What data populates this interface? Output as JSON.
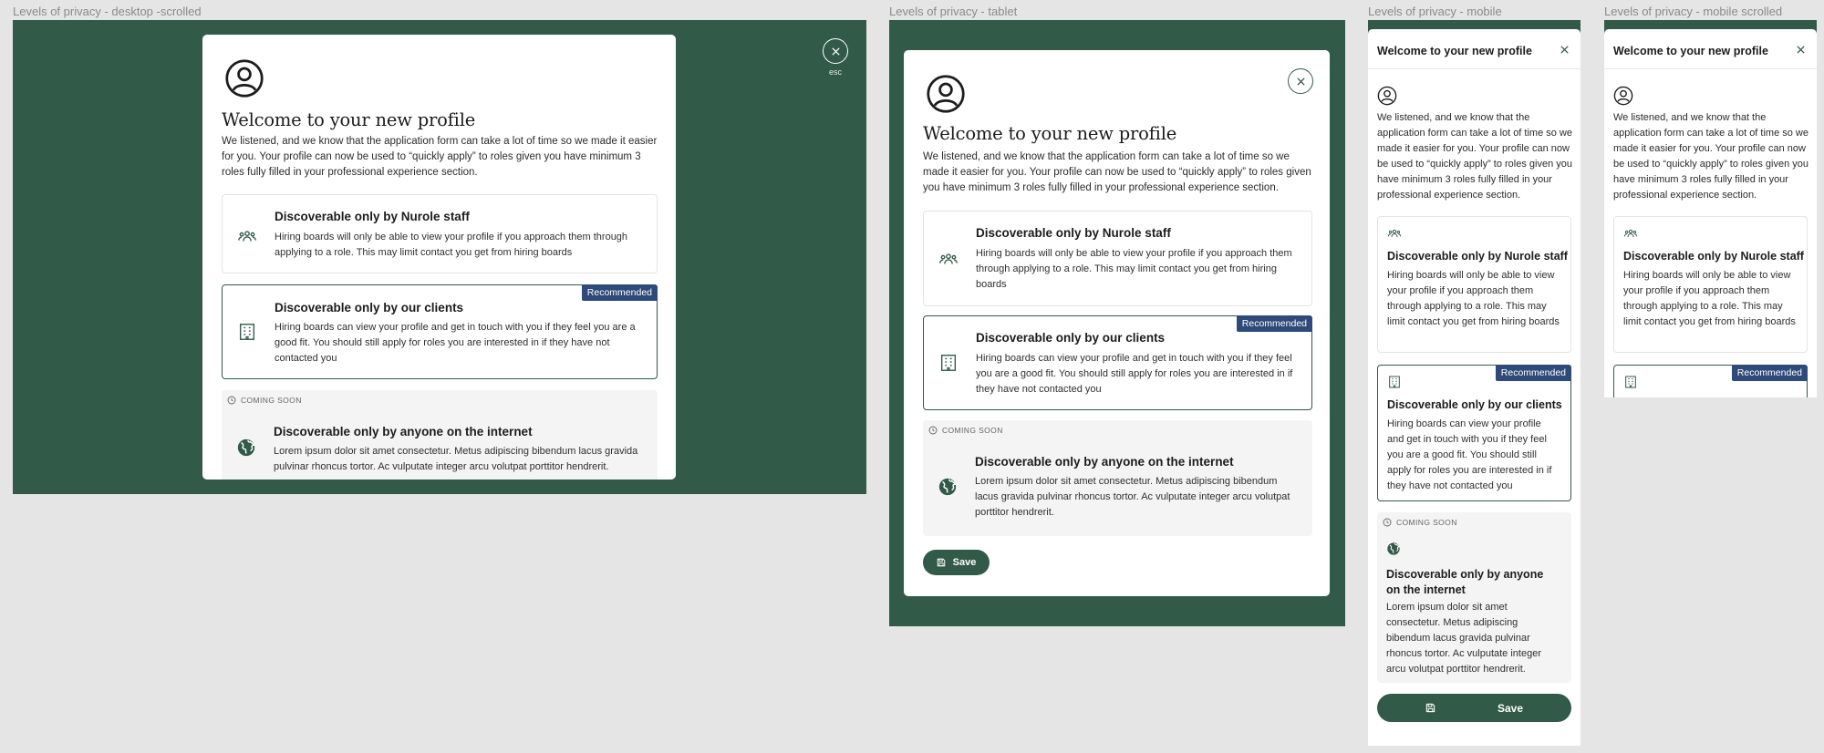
{
  "frames": {
    "desktop": "Levels of privacy - desktop -scrolled",
    "tablet": "Levels of privacy - tablet",
    "mobile": "Levels of privacy - mobile",
    "mobile_scrolled": "Levels of privacy - mobile scrolled"
  },
  "modal": {
    "title": "Welcome to your new profile",
    "intro": "We listened, and we know that the application form can take a lot of time so we made it easier for you. Your profile can now be used to “quickly apply” to roles given you have minimum 3 roles fully filled in your professional experience section.",
    "esc_label": "esc",
    "save_label": "Save",
    "options": [
      {
        "title": "Discoverable only by Nurole staff",
        "description": "Hiring boards will only be able to view your profile if you approach them through applying to a role. This may limit contact you get from hiring boards",
        "icon": "group-icon"
      },
      {
        "title": "Discoverable only by our clients",
        "description": "Hiring boards can view your profile and get in touch with you if they feel you are a good fit. You should still apply for roles you are interested in if they have not contacted you",
        "badge": "Recommended",
        "icon": "building-icon"
      },
      {
        "title": "Discoverable only by anyone on the internet",
        "description": "Lorem ipsum dolor sit amet consectetur. Metus adipiscing bibendum lacus gravida pulvinar rhoncus tortor. Ac vulputate integer arcu volutpat porttitor hendrerit.",
        "status": "COMING SOON",
        "icon": "globe-icon"
      }
    ]
  },
  "colors": {
    "brand_green": "#325a49",
    "badge_blue": "#2e4a7a",
    "canvas": "#e5e5e5"
  }
}
